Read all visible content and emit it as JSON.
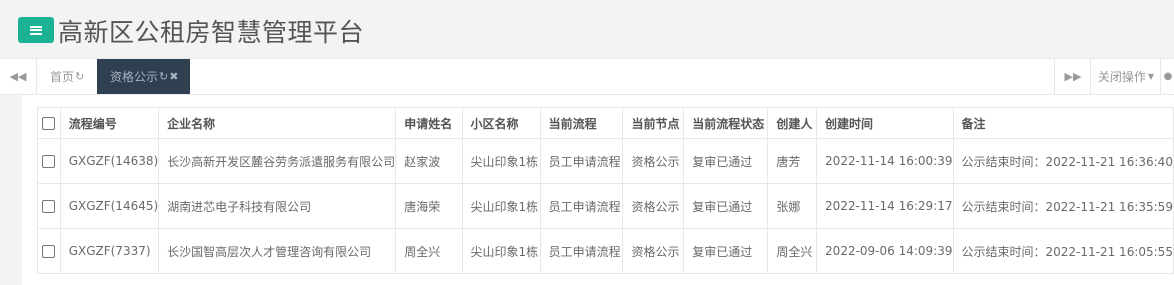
{
  "header": {
    "title": "高新区公租房智慧管理平台",
    "menu_icon": "hamburger-icon",
    "accent_color": "#1ab394"
  },
  "tabs": {
    "home_label": "首页",
    "active_label": "资格公示",
    "close_ops_label": "关闭操作",
    "active_tab_color": "#2f4050"
  },
  "table": {
    "columns": [
      "流程编号",
      "企业名称",
      "申请姓名",
      "小区名称",
      "当前流程",
      "当前节点",
      "当前流程状态",
      "创建人",
      "创建时间",
      "备注"
    ],
    "rows": [
      {
        "no": "GXGZF(14638)",
        "company": "长沙高新开发区麓谷劳务派遣服务有限公司",
        "applicant": "赵家波",
        "community": "尖山印象1栋",
        "flow": "员工申请流程",
        "node": "资格公示",
        "status": "复审已通过",
        "creator": "唐芳",
        "created": "2022-11-14 16:00:39",
        "remark": "公示结束时间：2022-11-21 16:36:40"
      },
      {
        "no": "GXGZF(14645)",
        "company": "湖南进芯电子科技有限公司",
        "applicant": "唐海荣",
        "community": "尖山印象1栋",
        "flow": "员工申请流程",
        "node": "资格公示",
        "status": "复审已通过",
        "creator": "张娜",
        "created": "2022-11-14 16:29:17",
        "remark": "公示结束时间：2022-11-21 16:35:59"
      },
      {
        "no": "GXGZF(7337)",
        "company": "长沙国智高层次人才管理咨询有限公司",
        "applicant": "周全兴",
        "community": "尖山印象1栋",
        "flow": "员工申请流程",
        "node": "资格公示",
        "status": "复审已通过",
        "creator": "周全兴",
        "created": "2022-09-06 14:09:39",
        "remark": "公示结束时间：2022-11-21 16:05:55"
      }
    ]
  }
}
